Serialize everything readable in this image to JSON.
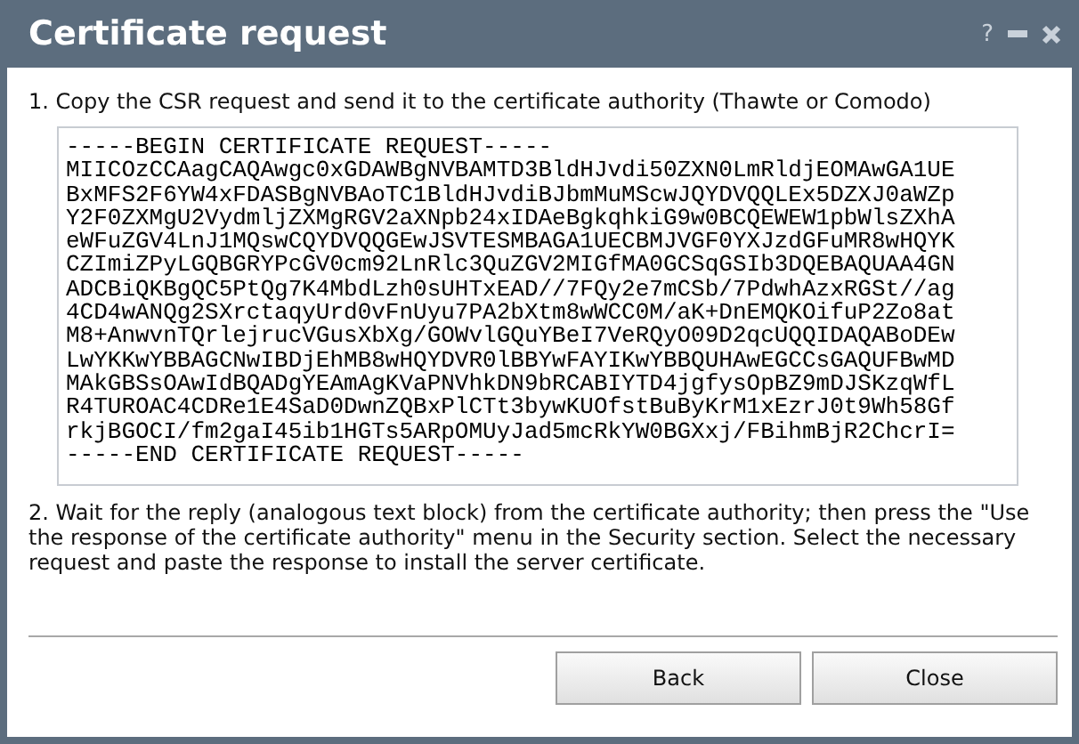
{
  "window": {
    "title": "Certificate request",
    "controls": [
      "?"
    ]
  },
  "step_1": "1. Copy the CSR request and send it to the certificate authority (Thawte or Comodo)",
  "csr_lines": [
    "-----BEGIN CERTIFICATE REQUEST-----",
    "MIICOzCCAagCAQAwgc0xGDAWBgNVBAMTD3BldHJvdi50ZXN0LmRldjEOMAwGA1UE",
    "BxMFS2F6YW4xFDASBgNVBAoTC1BldHJvdiBJbmMuMScwJQYDVQQLEx5DZXJ0aWZp",
    "Y2F0ZXMgU2VydmljZXMgRGV2aXNpb24xIDAeBgkqhkiG9w0BCQEWEW1pbWlsZXhA",
    "eWFuZGV4LnJ1MQswCQYDVQQGEwJSVTESMBAGA1UECBMJVGF0YXJzdGFuMR8wHQYK",
    "CZImiZPyLGQBGRYPcGV0cm92LnRlc3QuZGV2MIGfMA0GCSqGSIb3DQEBAQUAA4GN",
    "ADCBiQKBgQC5PtQg7K4MbdLzh0sUHTxEAD//7FQy2e7mCSb/7PdwhAzxRGSt//ag",
    "4CD4wANQg2SXrctaqyUrd0vFnUyu7PA2bXtm8wWCC0M/aK+DnEMQKOifuP2Zo8at",
    "M8+AnwvnTQrlejrucVGusXbXg/GOWvlGQuYBeI7VeRQyO09D2qcUQQIDAQABoDEw",
    "LwYKKwYBBAGCNwIBDjEhMB8wHQYDVR0lBBYwFAYIKwYBBQUHAwEGCCsGAQUFBwMD",
    "MAkGBSsOAwIdBQADgYEAmAgKVaPNVhkDN9bRCABIYTD4jgfysOpBZ9mDJSKzqWfL",
    "R4TUROAC4CDRe1E4SaD0DwnZQBxPlCTt3bywKUOfstBuByKrM1xEzrJ0t9Wh58Gf",
    "rkjBGOCI/fm2gaI45ib1HGTs5ARpOMUyJad5mcRkYW0BGXxj/FBihmBjR2ChcrI=",
    "-----END CERTIFICATE REQUEST-----"
  ],
  "step_2": "2. Wait for the reply (analogous text block) from the certificate authority; then press the \"Use the response of the certificate authority\" menu in the Security section. Select the necessary request and paste the response to install the server certificate.",
  "buttons": [
    "Back",
    "Close"
  ]
}
